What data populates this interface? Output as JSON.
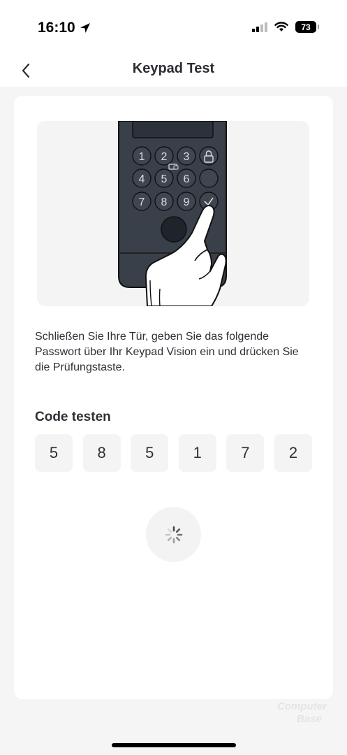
{
  "status_bar": {
    "time": "16:10",
    "battery": "73",
    "location_icon": "location-arrow-icon",
    "signal_icon": "cellular-signal-icon",
    "wifi_icon": "wifi-icon",
    "battery_icon": "battery-icon"
  },
  "nav": {
    "title": "Keypad Test",
    "back_icon": "chevron-left-icon"
  },
  "illustration": {
    "keys": [
      "1",
      "2",
      "3",
      "4",
      "5",
      "6",
      "7",
      "8",
      "9"
    ]
  },
  "instructions": "Schließen Sie Ihre Tür, geben Sie das folgende Passwort über Ihr Keypad Vision ein und drücken Sie die Prüfungstaste.",
  "code": {
    "heading": "Code testen",
    "digits": [
      "5",
      "8",
      "5",
      "1",
      "7",
      "2"
    ]
  },
  "spinner_icon": "loading-spinner-icon",
  "watermark": {
    "line1": "Computer",
    "line2": "Base"
  },
  "colors": {
    "background": "#f5f5f5",
    "card": "#ffffff",
    "tile": "#f4f4f5",
    "text": "#2b2d33",
    "keypad": "#3a4049"
  }
}
